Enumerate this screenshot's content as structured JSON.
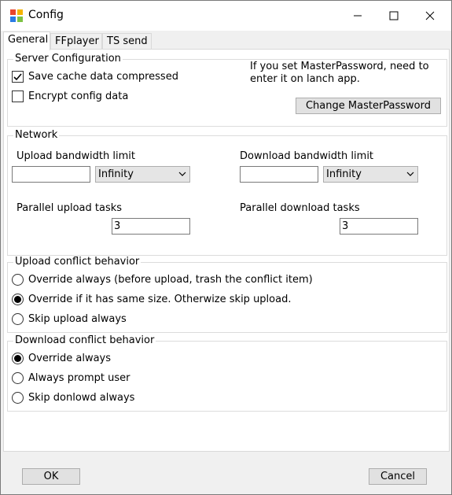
{
  "window": {
    "title": "Config",
    "title_icon": "app-icon"
  },
  "tabs": [
    {
      "label": "General",
      "active": true
    },
    {
      "label": "FFplayer",
      "active": false
    },
    {
      "label": "TS send",
      "active": false
    }
  ],
  "server": {
    "legend": "Server Configuration",
    "save_cache_label": "Save cache data compressed",
    "save_cache_checked": true,
    "encrypt_label": "Encrypt config data",
    "encrypt_checked": false,
    "note_line1": "If you set MasterPassword, need to",
    "note_line2": "enter it on lanch app.",
    "change_button": "Change MasterPassword"
  },
  "network": {
    "legend": "Network",
    "upload_label": "Upload bandwidth limit",
    "upload_value": "",
    "upload_unit": "Infinity",
    "download_label": "Download bandwidth limit",
    "download_value": "",
    "download_unit": "Infinity",
    "parallel_upload_label": "Parallel upload tasks",
    "parallel_upload_value": "3",
    "parallel_download_label": "Parallel download tasks",
    "parallel_download_value": "3"
  },
  "upload_conflict": {
    "legend": "Upload conflict behavior",
    "options": [
      {
        "label": "Override always (before upload, trash the conflict item)",
        "selected": false
      },
      {
        "label": "Override if it has same size. Otherwize skip upload.",
        "selected": true
      },
      {
        "label": "Skip upload always",
        "selected": false
      }
    ]
  },
  "download_conflict": {
    "legend": "Download conflict behavior",
    "options": [
      {
        "label": "Override always",
        "selected": true
      },
      {
        "label": "Always prompt user",
        "selected": false
      },
      {
        "label": "Skip donlowd always",
        "selected": false
      }
    ]
  },
  "footer": {
    "ok": "OK",
    "cancel": "Cancel"
  }
}
